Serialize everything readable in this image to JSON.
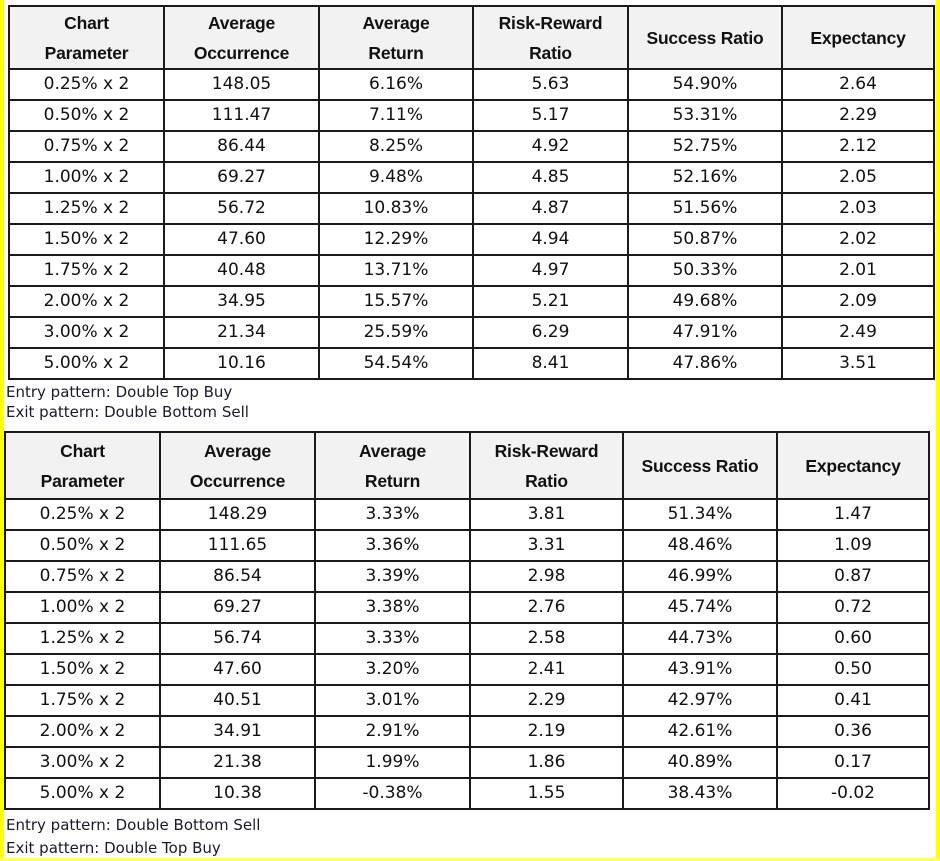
{
  "columns": [
    "Chart Parameter",
    "Average Occurrence",
    "Average Return",
    "Risk-Reward Ratio",
    "Success Ratio",
    "Expectancy"
  ],
  "column_lines": [
    [
      "Chart",
      "Parameter"
    ],
    [
      "Average",
      "Occurrence"
    ],
    [
      "Average",
      "Return"
    ],
    [
      "Risk-Reward",
      "Ratio"
    ],
    [
      "Success Ratio"
    ],
    [
      "Expectancy"
    ]
  ],
  "tables": [
    {
      "entry_pattern": "Entry pattern: Double Top Buy",
      "exit_pattern": "Exit pattern: Double Bottom Sell",
      "rows": [
        [
          "0.25% x 2",
          "148.05",
          "6.16%",
          "5.63",
          "54.90%",
          "2.64"
        ],
        [
          "0.50% x 2",
          "111.47",
          "7.11%",
          "5.17",
          "53.31%",
          "2.29"
        ],
        [
          "0.75% x 2",
          "86.44",
          "8.25%",
          "4.92",
          "52.75%",
          "2.12"
        ],
        [
          "1.00% x 2",
          "69.27",
          "9.48%",
          "4.85",
          "52.16%",
          "2.05"
        ],
        [
          "1.25% x 2",
          "56.72",
          "10.83%",
          "4.87",
          "51.56%",
          "2.03"
        ],
        [
          "1.50% x 2",
          "47.60",
          "12.29%",
          "4.94",
          "50.87%",
          "2.02"
        ],
        [
          "1.75% x 2",
          "40.48",
          "13.71%",
          "4.97",
          "50.33%",
          "2.01"
        ],
        [
          "2.00% x 2",
          "34.95",
          "15.57%",
          "5.21",
          "49.68%",
          "2.09"
        ],
        [
          "3.00% x 2",
          "21.34",
          "25.59%",
          "6.29",
          "47.91%",
          "2.49"
        ],
        [
          "5.00% x 2",
          "10.16",
          "54.54%",
          "8.41",
          "47.86%",
          "3.51"
        ]
      ]
    },
    {
      "entry_pattern": "Entry pattern: Double Bottom Sell",
      "exit_pattern": "Exit pattern: Double Top Buy",
      "rows": [
        [
          "0.25% x 2",
          "148.29",
          "3.33%",
          "3.81",
          "51.34%",
          "1.47"
        ],
        [
          "0.50% x 2",
          "111.65",
          "3.36%",
          "3.31",
          "48.46%",
          "1.09"
        ],
        [
          "0.75% x 2",
          "86.54",
          "3.39%",
          "2.98",
          "46.99%",
          "0.87"
        ],
        [
          "1.00% x 2",
          "69.27",
          "3.38%",
          "2.76",
          "45.74%",
          "0.72"
        ],
        [
          "1.25% x 2",
          "56.74",
          "3.33%",
          "2.58",
          "44.73%",
          "0.60"
        ],
        [
          "1.50% x 2",
          "47.60",
          "3.20%",
          "2.41",
          "43.91%",
          "0.50"
        ],
        [
          "1.75% x 2",
          "40.51",
          "3.01%",
          "2.29",
          "42.97%",
          "0.41"
        ],
        [
          "2.00% x 2",
          "34.91",
          "2.91%",
          "2.19",
          "42.61%",
          "0.36"
        ],
        [
          "3.00% x 2",
          "21.38",
          "1.99%",
          "1.86",
          "40.89%",
          "0.17"
        ],
        [
          "5.00% x 2",
          "10.38",
          "-0.38%",
          "1.55",
          "38.43%",
          "-0.02"
        ]
      ]
    }
  ],
  "colors": {
    "frame_accent": "#ffff00",
    "header_background": "#f2f2f2",
    "border": "#1a1a1a"
  }
}
